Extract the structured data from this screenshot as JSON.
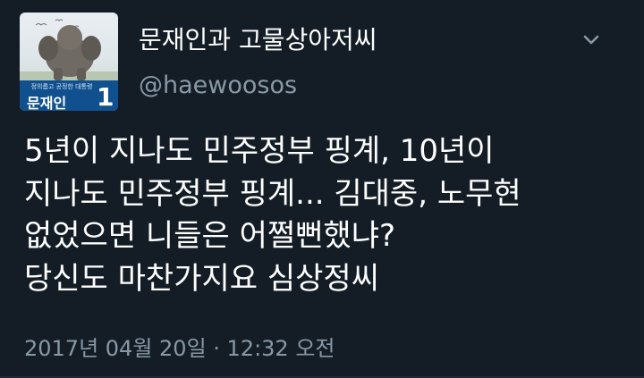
{
  "profile": {
    "display_name": "문재인과 고물상아저씨",
    "handle": "@haewoosos",
    "avatar": {
      "slogan": "정의롭고 공정한 대통령",
      "name": "문재인",
      "number": "1"
    }
  },
  "tweet": {
    "lines": [
      "5년이 지나도 민주정부 핑계, 10년이",
      "지나도 민주정부 핑계... 김대중, 노무현",
      "없었으면 니들은 어쩔뻔했냐?",
      "당신도 마찬가지요 심상정씨"
    ],
    "timestamp": "2017년 04월 20일 · 12:32 오전"
  },
  "icons": {
    "menu": "chevron-down-icon"
  },
  "colors": {
    "background": "#141d26",
    "text_primary": "#ffffff",
    "text_secondary": "#8899a6",
    "avatar_banner": "#11508f"
  }
}
